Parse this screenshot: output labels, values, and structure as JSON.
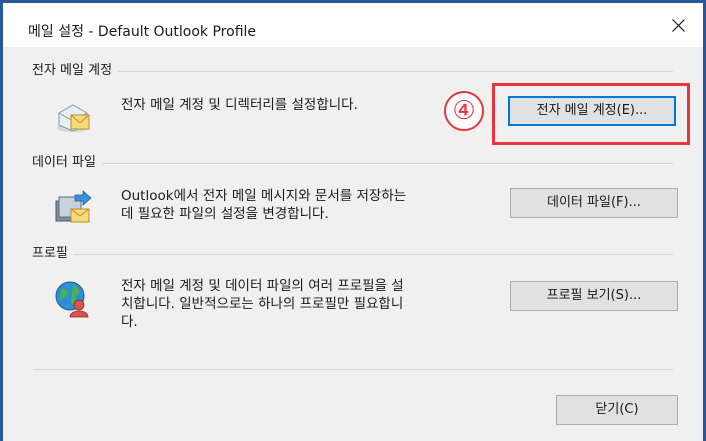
{
  "window": {
    "title": "메일 설정 - Default Outlook Profile",
    "close_glyph": "×"
  },
  "email": {
    "header": "전자 메일 계정",
    "description": "전자 메일 계정 및 디렉터리를 설정합니다.",
    "button": "전자 메일 계정(E)...",
    "icon": "email-accounts-icon"
  },
  "data_files": {
    "header": "데이터 파일",
    "description": "Outlook에서 전자 메일 메시지와 문서를 저장하는\n데 필요한 파일의 설정을 변경합니다.",
    "button": "데이터 파일(F)...",
    "icon": "data-files-icon"
  },
  "profiles": {
    "header": "프로필",
    "description": "전자 메일 계정 및 데이터 파일의 여러 프로필을 설\n치합니다. 일반적으로는 하나의 프로필만 필요합니\n다.",
    "button": "프로필 보기(S)...",
    "icon": "profiles-icon"
  },
  "footer": {
    "close_button": "닫기(C)"
  },
  "annotation": {
    "step_number": "④",
    "color": "#e8363e"
  }
}
